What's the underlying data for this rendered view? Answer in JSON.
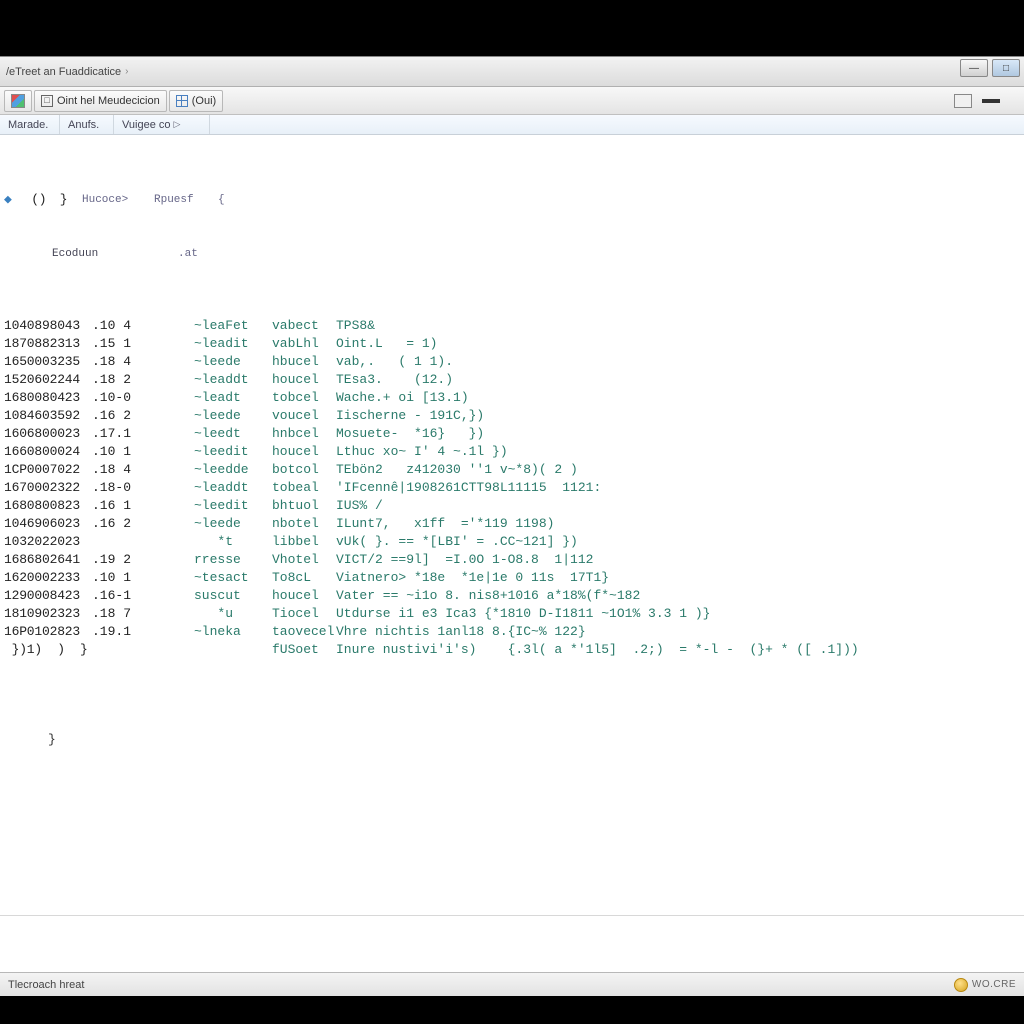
{
  "titlebar": {
    "path_prefix": "/eTreet an Fuaddicatice",
    "arrow": "›"
  },
  "window_controls": {
    "minimize": "—",
    "maximize": "□"
  },
  "toolbar": {
    "btn1_label": "Oint hel Meudecicion",
    "btn2_label": "(Oui)"
  },
  "subheader": {
    "col1": "Marade.",
    "col2": "Anufs.",
    "col3": "Vuigee co"
  },
  "head1": {
    "id": "  ()",
    "dot": " }",
    "op": "Hucoce>",
    "reg": "Rpuesf",
    "args": "{"
  },
  "head2": {
    "op": "Ecoduun",
    "args": ".at"
  },
  "rows": [
    {
      "id": "1040898043",
      "dot": ".10 4",
      "op": "~leaFet",
      "reg": "vabect",
      "args": "TPS8&"
    },
    {
      "id": "1870882313",
      "dot": ".15 1",
      "op": "~leadit",
      "reg": "vabLhl",
      "args": "Oint.L   = 1)"
    },
    {
      "id": "1650003235",
      "dot": ".18 4",
      "op": "~leede",
      "reg": "hbucel",
      "args": "vab,.   ( 1 1)."
    },
    {
      "id": "1520602244",
      "dot": ".18 2",
      "op": "~leaddt",
      "reg": "houcel",
      "args": "TEsa3.    (12.)"
    },
    {
      "id": "1680080423",
      "dot": ".10-0",
      "op": "~leadt",
      "reg": "tobcel",
      "args": "Wache.+ oi [13.1)"
    },
    {
      "id": "1084603592",
      "dot": ".16 2",
      "op": "~leede",
      "reg": "voucel",
      "args": "Iischerne - 191C,})"
    },
    {
      "id": "1606800023",
      "dot": ".17.1",
      "op": "~leedt",
      "reg": "hnbcel",
      "args": "Mosuete-  *16}   })"
    },
    {
      "id": "1660800024",
      "dot": ".10 1",
      "op": "~leedit",
      "reg": "houcel",
      "args": "Lthuc xo~ I' 4 ~.1l })"
    },
    {
      "id": "1CP0007022",
      "dot": ".18 4",
      "op": "~leedde",
      "reg": "botcol",
      "args": "TEbön2   z412030 ''1 v~*8)( 2 )"
    },
    {
      "id": "1670002322",
      "dot": ".18-0",
      "op": "~leaddt",
      "reg": "tobeal",
      "args": "'IFcennê|1908261CTT98L11115  1121:"
    },
    {
      "id": "1680800823",
      "dot": ".16 1",
      "op": "~leedit",
      "reg": "bhtuol",
      "args": "IUS% /"
    },
    {
      "id": "1046906023",
      "dot": ".16 2",
      "op": "~leede",
      "reg": "nbotel",
      "args": "ILunt7,   x1ff  ='*119 1198)"
    },
    {
      "id": "1032022023",
      "dot": "     ",
      "op": "   *t",
      "reg": "libbel",
      "args": "vUk( }. == *[LBI' = .CC~121] })"
    },
    {
      "id": "1686802641",
      "dot": ".19 2",
      "op": "rresse",
      "reg": "Vhotel",
      "args": "VICT/2 ==9l]  =I.0O 1-O8.8  1|112"
    },
    {
      "id": "1620002233",
      "dot": ".10 1",
      "op": "~tesact",
      "reg": "To8cL",
      "args": "Viatnero> *18e  *1e|1e 0 11s  17T1}"
    },
    {
      "id": "1290008423",
      "dot": ".16-1",
      "op": "suscut",
      "reg": "houcel",
      "args": "Vater == ~i1o 8. nis8+1016 a*18%(f*~182"
    },
    {
      "id": "1810902323",
      "dot": ".18 7",
      "op": "   *u",
      "reg": "Tiocel",
      "args": "Utdurse i1 e3 Ica3 {*1810 D-I1811 ~1O1% 3.3 1 )}"
    },
    {
      "id": "16P0102823",
      "dot": ".19.1",
      "op": "~lneka",
      "reg": "taovecel",
      "args": "Vhre nichtis 1anl18 8.{IC~% 122}"
    },
    {
      "id": " })1)  )  }",
      "dot": "    ",
      "op": " ",
      "reg": "fUSoet",
      "args": "Inure nustivi'i's)    {.3l( a *'1l5]  .2;)  = *-l -  (}+ * ([ .1]))"
    }
  ],
  "tail": {
    "brace": "}"
  },
  "statusbar": {
    "left": "Tlecroach hreat",
    "brand": "WO.CRE"
  }
}
